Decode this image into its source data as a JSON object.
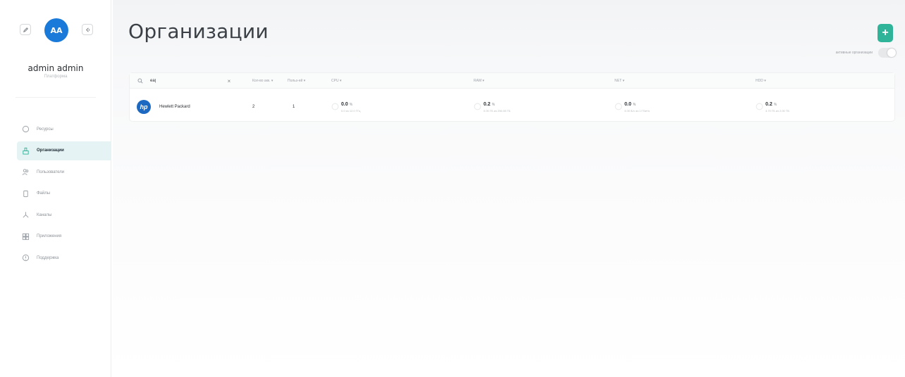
{
  "user": {
    "initials": "AA",
    "name": "admin admin",
    "role": "Платформа"
  },
  "nav": [
    {
      "label": "Ресурсы",
      "icon": "resources-icon",
      "active": false
    },
    {
      "label": "Организации",
      "icon": "organizations-icon",
      "active": true
    },
    {
      "label": "Пользователи",
      "icon": "users-icon",
      "active": false
    },
    {
      "label": "Файлы",
      "icon": "files-icon",
      "active": false
    },
    {
      "label": "Каналы",
      "icon": "channels-icon",
      "active": false
    },
    {
      "label": "Приложения",
      "icon": "apps-icon",
      "active": false
    },
    {
      "label": "Поддержка",
      "icon": "support-icon",
      "active": false
    }
  ],
  "page": {
    "title": "Организации",
    "add_label": "+",
    "toggle_label": "активные организации",
    "toggle_on": false
  },
  "table": {
    "search_value": "ea|",
    "search_placeholder": "",
    "columns": [
      "Кол-во акк.",
      "Польз-ей",
      "CPU",
      "RAM",
      "NET",
      "HDD"
    ],
    "rows": [
      {
        "name": "Hewlett Packard",
        "accounts": "2",
        "users": "1",
        "cpu": {
          "value": "0.0",
          "unit": "%",
          "sub": "0.0 из 12.0 ГГц"
        },
        "ram": {
          "value": "0.2",
          "unit": "%",
          "sub": "0.00 ГБ из 256.00 ГБ"
        },
        "net": {
          "value": "0.0",
          "unit": "%",
          "sub": "0.00 Б/с из 1 Гбит/с"
        },
        "hdd": {
          "value": "0.2",
          "unit": "%",
          "sub": "4.70 ГБ из 2.00 ТБ"
        }
      }
    ]
  },
  "colors": {
    "accent": "#2fb49a",
    "avatar": "#1a7ad9",
    "active_nav_bg": "#e5f3f4",
    "hp_logo": "#1d69c2"
  }
}
